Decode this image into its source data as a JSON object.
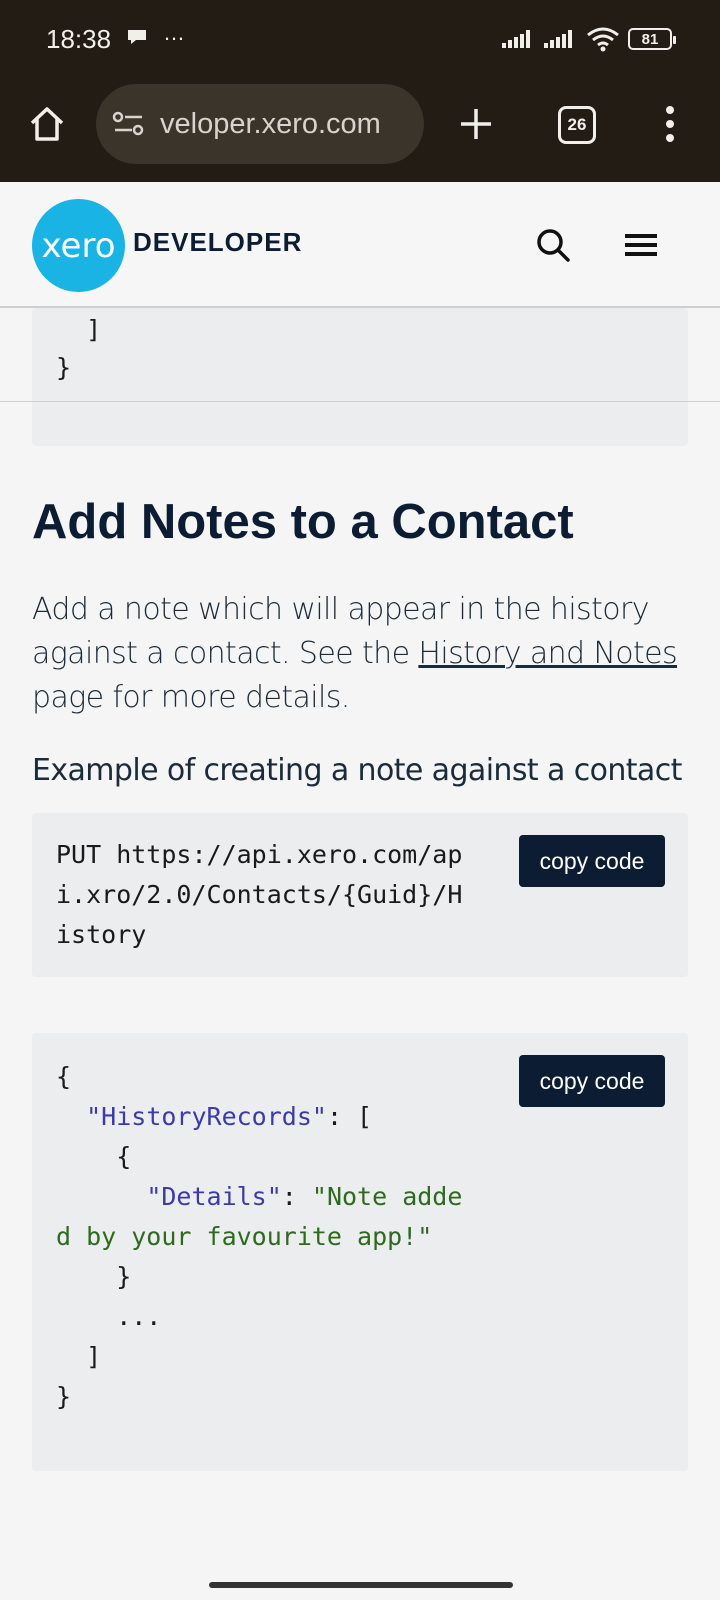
{
  "status_bar": {
    "time": "18:38",
    "dots": "…",
    "battery": "81"
  },
  "browser": {
    "url": "veloper.xero.com",
    "tab_count": "26"
  },
  "site_header": {
    "logo_text": "xero",
    "brand_word": "DEVELOPER"
  },
  "prev_code": {
    "lines": [
      "  ]",
      "}"
    ]
  },
  "section": {
    "title": "Add Notes to a Contact",
    "desc_pre": "Add a note which will appear in the history against a contact. See the ",
    "desc_link": "History and Notes",
    "desc_post": " page for more details.",
    "example_label": "Example of creating a note against a contact"
  },
  "request_code": {
    "lines": [
      "PUT https://api.xero.com/ap",
      "i.xro/2.0/Contacts/{Guid}/H",
      "istory"
    ],
    "copy_label": "copy code"
  },
  "body_code": {
    "line1": "{",
    "line2_indent": "  ",
    "line2_key": "\"HistoryRecords\"",
    "line2_rest": ": [",
    "line3": "    {",
    "line4_indent": "      ",
    "line4_key": "\"Details\"",
    "line4_colon": ": ",
    "line4_val": "\"Note adde",
    "line5_val": "d by your favourite app!\"",
    "line6": "    }",
    "line7": "    ...",
    "line8": "  ]",
    "line9": "}",
    "copy_label": "copy code"
  },
  "colors": {
    "brand": "#1ab4e4",
    "navy": "#0b1c33",
    "code_key": "#3d3aa8",
    "code_string": "#2d6a1f"
  }
}
